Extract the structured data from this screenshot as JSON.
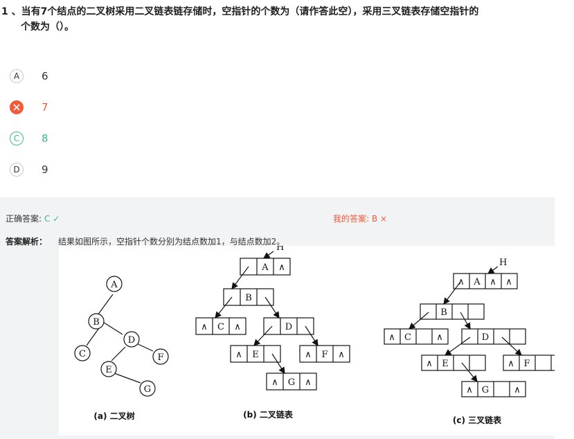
{
  "question": {
    "line1": "1 、当有7个结点的二叉树采用二叉链表链存储时，空指针的个数为（请作答此空），采用三叉链表存储空指针的",
    "line2": "个数为（）。"
  },
  "options": [
    {
      "letter": "A",
      "text": "6"
    },
    {
      "letter": "B",
      "text": "7"
    },
    {
      "letter": "C",
      "text": "8"
    },
    {
      "letter": "D",
      "text": "9"
    }
  ],
  "result": {
    "correct_label": "正确答案:",
    "correct_value": "C ✓",
    "my_label": "我的答案:",
    "my_value": "B ×",
    "analysis_label": "答案解析：",
    "analysis_text": "结果如图所示，空指针个数分别为结点数加1，与结点数加2。"
  },
  "figure": {
    "tree_nodes": [
      "A",
      "B",
      "C",
      "D",
      "E",
      "F",
      "G"
    ],
    "head_label": "H",
    "null_symbol": "∧",
    "caption_a": "(a) 二叉树",
    "caption_b": "(b) 二叉链表",
    "caption_c": "(c) 三叉链表"
  },
  "colors": {
    "correct": "#3fb68e",
    "wrong": "#f25a3c",
    "panel": "#f2f3f5"
  },
  "icons": {
    "wrong_option": "x-circle-icon",
    "check": "check-icon",
    "cross": "cross-icon"
  }
}
